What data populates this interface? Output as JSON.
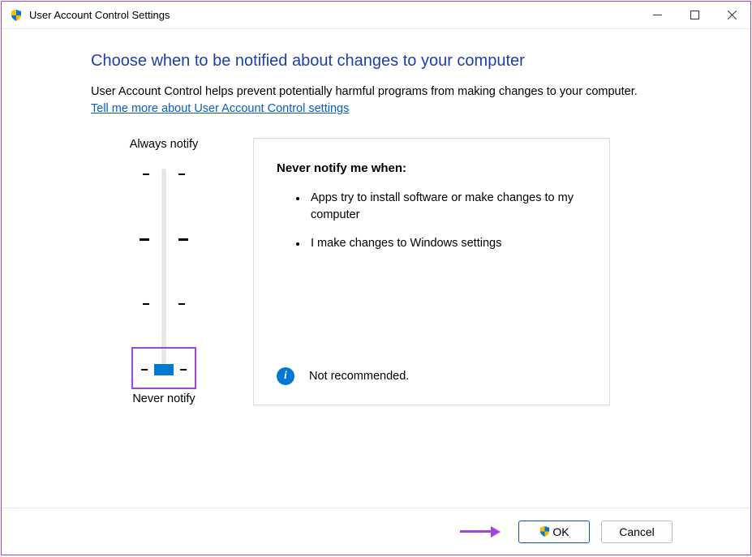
{
  "titlebar": {
    "title": "User Account Control Settings"
  },
  "content": {
    "headline": "Choose when to be notified about changes to your computer",
    "description": "User Account Control helps prevent potentially harmful programs from making changes to your computer.",
    "learn_more": "Tell me more about User Account Control settings"
  },
  "slider": {
    "top_label": "Always notify",
    "bottom_label": "Never notify",
    "level": 0,
    "levels_total": 4
  },
  "panel": {
    "title": "Never notify me when:",
    "bullets": [
      "Apps try to install software or make changes to my computer",
      "I make changes to Windows settings"
    ],
    "recommendation": "Not recommended."
  },
  "buttons": {
    "ok": "OK",
    "cancel": "Cancel"
  }
}
